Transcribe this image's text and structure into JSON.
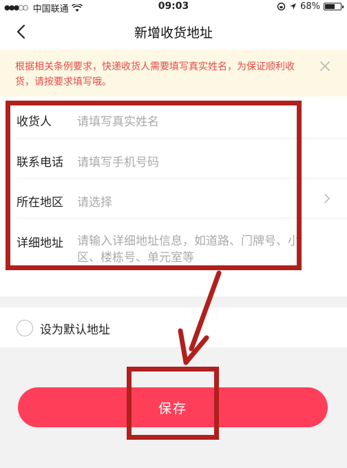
{
  "status_bar": {
    "carrier": "中国联通",
    "time": "09:03",
    "battery_percent": "68%",
    "battery_level": 0.68
  },
  "nav": {
    "title": "新增收货地址",
    "back_icon": "chevron-left-icon"
  },
  "notice": {
    "text": "根据相关条例要求，快递收货人需要填写真实姓名，为保证顺利收货，请按要求填写哦。",
    "close_icon": "close-icon"
  },
  "form": {
    "name": {
      "label": "收货人",
      "placeholder": "请填写真实姓名"
    },
    "phone": {
      "label": "联系电话",
      "placeholder": "请填写手机号码"
    },
    "region": {
      "label": "所在地区",
      "placeholder": "请选择"
    },
    "detail": {
      "label": "详细地址",
      "placeholder": "请输入详细地址信息，如道路、门牌号、小区、楼栋号、单元室等"
    }
  },
  "default_address": {
    "label": "设为默认地址",
    "checked": false
  },
  "save_button": {
    "label": "保存"
  },
  "colors": {
    "accent": "#ff3f59",
    "notice_text": "#e84a4a",
    "notice_bg": "#fdf8e3",
    "annotation": "#b0201d"
  }
}
